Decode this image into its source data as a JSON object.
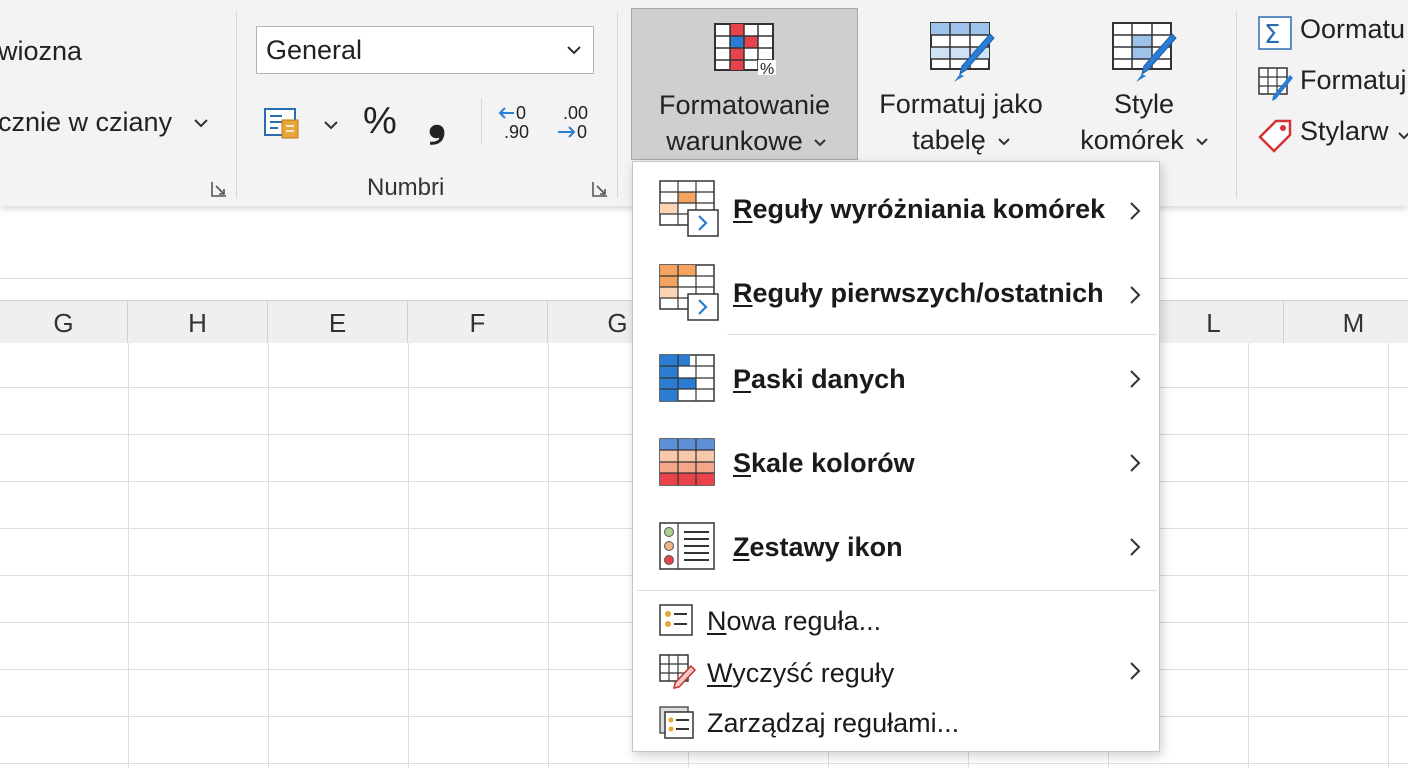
{
  "ribbon": {
    "alignment": {
      "wrap_label": "wiozna",
      "merge_label": "cznie w cziany"
    },
    "number": {
      "format_value": "General",
      "percent_glyph": "%",
      "comma_glyph": "❟",
      "group_label": "Numbri"
    },
    "styles": {
      "conditional_formatting": {
        "line1": "Formatowanie",
        "line2": "warunkowe"
      },
      "format_as_table": {
        "line1": "Formatuj jako",
        "line2": "tabelę"
      },
      "cell_styles": {
        "line1": "Style",
        "line2": "komórek"
      }
    },
    "cells": {
      "item1": "Oormatu",
      "item2": "Formatuj",
      "item3": "Stylarw"
    }
  },
  "grid": {
    "columns": [
      {
        "label": "G"
      },
      {
        "label": "H"
      },
      {
        "label": "E"
      },
      {
        "label": "F"
      },
      {
        "label": "G"
      },
      {
        "label": ""
      },
      {
        "label": ""
      },
      {
        "label": ""
      },
      {
        "label": "L"
      },
      {
        "label": "M"
      }
    ]
  },
  "menu": {
    "items": [
      {
        "underline": "R",
        "rest": "eguły wyróżniania komórek",
        "icon": "highlight-rules-icon"
      },
      {
        "underline": "R",
        "rest": "eguły pierwszych/ostatnich",
        "icon": "top-bottom-rules-icon"
      },
      {
        "underline": "P",
        "rest": "aski danych",
        "icon": "data-bars-icon"
      },
      {
        "underline": "S",
        "rest": "kale kolorów",
        "icon": "color-scales-icon"
      },
      {
        "underline": "Z",
        "rest": "estawy ikon",
        "icon": "icon-sets-icon"
      }
    ],
    "actions": [
      {
        "underline": "N",
        "rest": "owa reguła...",
        "icon": "new-rule-icon"
      },
      {
        "underline": "W",
        "rest": "yczyść reguły",
        "icon": "clear-rules-icon"
      },
      {
        "underline": "",
        "rest": "Zarządzaj regułami...",
        "icon": "manage-rules-icon"
      }
    ]
  },
  "colors": {
    "accent_blue": "#2b7cd3",
    "accent_red": "#e8434b",
    "accent_orange": "#f4a460",
    "ribbon_bg": "#f3f3f3",
    "active_button_bg": "#cfcfcf"
  }
}
